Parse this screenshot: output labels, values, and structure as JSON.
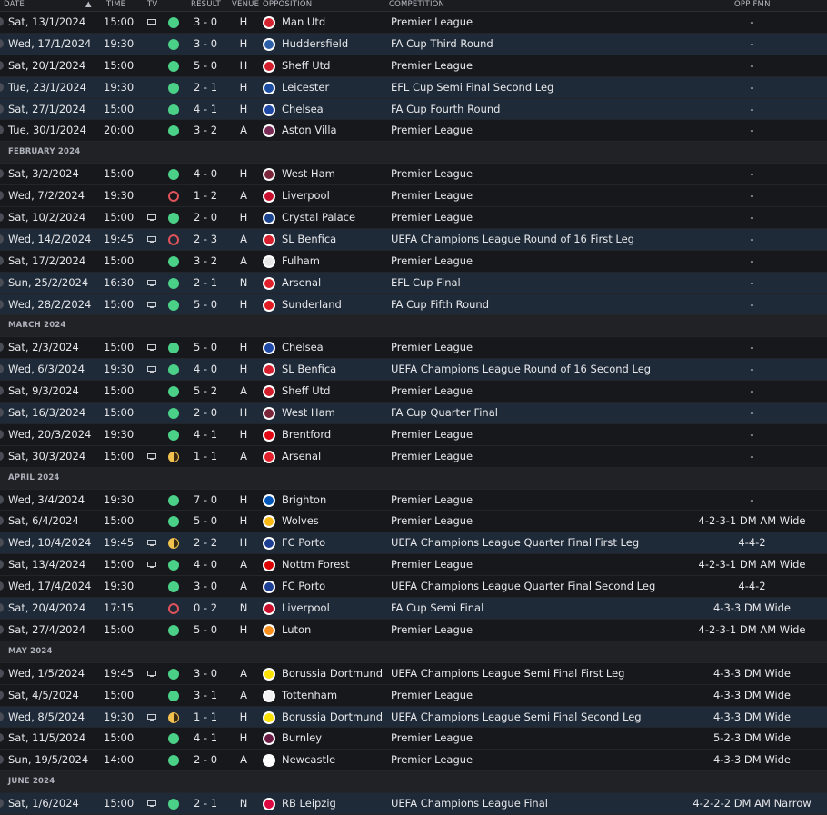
{
  "headers": {
    "date": "DATE",
    "time": "TIME",
    "tv": "TV",
    "result": "RESULT",
    "venue": "VENUE",
    "opposition": "OPPOSITION",
    "competition": "COMPETITION",
    "opp_fmn": "OPP FMN"
  },
  "colors": {
    "win": "#4bd187",
    "loss": "#e0535a",
    "draw": "#f2c14e",
    "row_highlight": "#1f2a38"
  },
  "rows": [
    {
      "type": "match",
      "date": "Sat, 13/1/2024",
      "time": "15:00",
      "tv": true,
      "result": "win",
      "score": "3 - 0",
      "venue": "H",
      "opp": "Man Utd",
      "badge": "#d5222f",
      "comp": "Premier League",
      "fmn": "-",
      "hl": false
    },
    {
      "type": "match",
      "date": "Wed, 17/1/2024",
      "time": "19:30",
      "tv": false,
      "result": "win",
      "score": "3 - 0",
      "venue": "H",
      "opp": "Huddersfield",
      "badge": "#2b5fa8",
      "comp": "FA Cup Third Round",
      "fmn": "-",
      "hl": true
    },
    {
      "type": "match",
      "date": "Sat, 20/1/2024",
      "time": "15:00",
      "tv": false,
      "result": "win",
      "score": "5 - 0",
      "venue": "H",
      "opp": "Sheff Utd",
      "badge": "#d21e2b",
      "comp": "Premier League",
      "fmn": "-",
      "hl": false
    },
    {
      "type": "match",
      "date": "Tue, 23/1/2024",
      "time": "19:30",
      "tv": false,
      "result": "win",
      "score": "2 - 1",
      "venue": "H",
      "opp": "Leicester",
      "badge": "#1c4ea3",
      "comp": "EFL Cup Semi Final Second Leg",
      "fmn": "-",
      "hl": true
    },
    {
      "type": "match",
      "date": "Sat, 27/1/2024",
      "time": "15:00",
      "tv": false,
      "result": "win",
      "score": "4 - 1",
      "venue": "H",
      "opp": "Chelsea",
      "badge": "#1e49a5",
      "comp": "FA Cup Fourth Round",
      "fmn": "-",
      "hl": true
    },
    {
      "type": "match",
      "date": "Tue, 30/1/2024",
      "time": "20:00",
      "tv": false,
      "result": "win",
      "score": "3 - 2",
      "venue": "A",
      "opp": "Aston Villa",
      "badge": "#7a2b55",
      "comp": "Premier League",
      "fmn": "-",
      "hl": false
    },
    {
      "type": "month",
      "label": "FEBRUARY 2024"
    },
    {
      "type": "match",
      "date": "Sat, 3/2/2024",
      "time": "15:00",
      "tv": false,
      "result": "win",
      "score": "4 - 0",
      "venue": "H",
      "opp": "West Ham",
      "badge": "#7a263a",
      "comp": "Premier League",
      "fmn": "-",
      "hl": false
    },
    {
      "type": "match",
      "date": "Wed, 7/2/2024",
      "time": "19:30",
      "tv": false,
      "result": "loss",
      "score": "1 - 2",
      "venue": "A",
      "opp": "Liverpool",
      "badge": "#c8102e",
      "comp": "Premier League",
      "fmn": "-",
      "hl": false
    },
    {
      "type": "match",
      "date": "Sat, 10/2/2024",
      "time": "15:00",
      "tv": true,
      "result": "win",
      "score": "2 - 0",
      "venue": "H",
      "opp": "Crystal Palace",
      "badge": "#1b458f",
      "comp": "Premier League",
      "fmn": "-",
      "hl": false
    },
    {
      "type": "match",
      "date": "Wed, 14/2/2024",
      "time": "19:45",
      "tv": true,
      "result": "loss",
      "score": "2 - 3",
      "venue": "A",
      "opp": "SL Benfica",
      "badge": "#d6202f",
      "comp": "UEFA Champions League Round of 16 First Leg",
      "fmn": "-",
      "hl": true
    },
    {
      "type": "match",
      "date": "Sat, 17/2/2024",
      "time": "15:00",
      "tv": false,
      "result": "win",
      "score": "3 - 2",
      "venue": "A",
      "opp": "Fulham",
      "badge": "#e8e8e8",
      "comp": "Premier League",
      "fmn": "-",
      "hl": false
    },
    {
      "type": "match",
      "date": "Sun, 25/2/2024",
      "time": "16:30",
      "tv": true,
      "result": "win",
      "score": "2 - 1",
      "venue": "N",
      "opp": "Arsenal",
      "badge": "#e2202b",
      "comp": "EFL Cup Final",
      "fmn": "-",
      "hl": true
    },
    {
      "type": "match",
      "date": "Wed, 28/2/2024",
      "time": "15:00",
      "tv": true,
      "result": "win",
      "score": "5 - 0",
      "venue": "H",
      "opp": "Sunderland",
      "badge": "#e11b22",
      "comp": "FA Cup Fifth Round",
      "fmn": "-",
      "hl": true
    },
    {
      "type": "month",
      "label": "MARCH 2024"
    },
    {
      "type": "match",
      "date": "Sat, 2/3/2024",
      "time": "15:00",
      "tv": true,
      "result": "win",
      "score": "5 - 0",
      "venue": "H",
      "opp": "Chelsea",
      "badge": "#1e49a5",
      "comp": "Premier League",
      "fmn": "-",
      "hl": false
    },
    {
      "type": "match",
      "date": "Wed, 6/3/2024",
      "time": "19:30",
      "tv": true,
      "result": "win",
      "score": "4 - 0",
      "venue": "H",
      "opp": "SL Benfica",
      "badge": "#d6202f",
      "comp": "UEFA Champions League Round of 16 Second Leg",
      "fmn": "-",
      "hl": true
    },
    {
      "type": "match",
      "date": "Sat, 9/3/2024",
      "time": "15:00",
      "tv": false,
      "result": "win",
      "score": "5 - 2",
      "venue": "A",
      "opp": "Sheff Utd",
      "badge": "#d21e2b",
      "comp": "Premier League",
      "fmn": "-",
      "hl": false
    },
    {
      "type": "match",
      "date": "Sat, 16/3/2024",
      "time": "15:00",
      "tv": false,
      "result": "win",
      "score": "2 - 0",
      "venue": "H",
      "opp": "West Ham",
      "badge": "#7a263a",
      "comp": "FA Cup Quarter Final",
      "fmn": "-",
      "hl": true
    },
    {
      "type": "match",
      "date": "Wed, 20/3/2024",
      "time": "19:30",
      "tv": false,
      "result": "win",
      "score": "4 - 1",
      "venue": "H",
      "opp": "Brentford",
      "badge": "#e30613",
      "comp": "Premier League",
      "fmn": "-",
      "hl": false
    },
    {
      "type": "match",
      "date": "Sat, 30/3/2024",
      "time": "15:00",
      "tv": true,
      "result": "draw",
      "score": "1 - 1",
      "venue": "A",
      "opp": "Arsenal",
      "badge": "#e2202b",
      "comp": "Premier League",
      "fmn": "-",
      "hl": false
    },
    {
      "type": "month",
      "label": "APRIL 2024"
    },
    {
      "type": "match",
      "date": "Wed, 3/4/2024",
      "time": "19:30",
      "tv": false,
      "result": "win",
      "score": "7 - 0",
      "venue": "H",
      "opp": "Brighton",
      "badge": "#0057b8",
      "comp": "Premier League",
      "fmn": "-",
      "hl": false
    },
    {
      "type": "match",
      "date": "Sat, 6/4/2024",
      "time": "15:00",
      "tv": false,
      "result": "win",
      "score": "5 - 0",
      "venue": "H",
      "opp": "Wolves",
      "badge": "#fdb913",
      "comp": "Premier League",
      "fmn": "4-2-3-1 DM AM Wide",
      "hl": false
    },
    {
      "type": "match",
      "date": "Wed, 10/4/2024",
      "time": "19:45",
      "tv": true,
      "result": "draw",
      "score": "2 - 2",
      "venue": "H",
      "opp": "FC Porto",
      "badge": "#1c3f94",
      "comp": "UEFA Champions League Quarter Final First Leg",
      "fmn": "4-4-2",
      "hl": true
    },
    {
      "type": "match",
      "date": "Sat, 13/4/2024",
      "time": "15:00",
      "tv": true,
      "result": "win",
      "score": "4 - 0",
      "venue": "A",
      "opp": "Nottm Forest",
      "badge": "#dd0000",
      "comp": "Premier League",
      "fmn": "4-2-3-1 DM AM Wide",
      "hl": false
    },
    {
      "type": "match",
      "date": "Wed, 17/4/2024",
      "time": "19:30",
      "tv": false,
      "result": "win",
      "score": "3 - 0",
      "venue": "A",
      "opp": "FC Porto",
      "badge": "#1c3f94",
      "comp": "UEFA Champions League Quarter Final Second Leg",
      "fmn": "4-4-2",
      "hl": false
    },
    {
      "type": "match",
      "date": "Sat, 20/4/2024",
      "time": "17:15",
      "tv": false,
      "result": "loss",
      "score": "0 - 2",
      "venue": "N",
      "opp": "Liverpool",
      "badge": "#c8102e",
      "comp": "FA Cup Semi Final",
      "fmn": "4-3-3 DM Wide",
      "hl": true
    },
    {
      "type": "match",
      "date": "Sat, 27/4/2024",
      "time": "15:00",
      "tv": false,
      "result": "win",
      "score": "5 - 0",
      "venue": "H",
      "opp": "Luton",
      "badge": "#f78f1e",
      "comp": "Premier League",
      "fmn": "4-2-3-1 DM AM Wide",
      "hl": false
    },
    {
      "type": "month",
      "label": "MAY 2024"
    },
    {
      "type": "match",
      "date": "Wed, 1/5/2024",
      "time": "19:45",
      "tv": true,
      "result": "win",
      "score": "3 - 0",
      "venue": "A",
      "opp": "Borussia Dortmund",
      "badge": "#fde100",
      "comp": "UEFA Champions League Semi Final First Leg",
      "fmn": "4-3-3 DM Wide",
      "hl": false
    },
    {
      "type": "match",
      "date": "Sat, 4/5/2024",
      "time": "15:00",
      "tv": false,
      "result": "win",
      "score": "3 - 1",
      "venue": "A",
      "opp": "Tottenham",
      "badge": "#f2f2f2",
      "comp": "Premier League",
      "fmn": "4-3-3 DM Wide",
      "hl": false
    },
    {
      "type": "match",
      "date": "Wed, 8/5/2024",
      "time": "19:30",
      "tv": true,
      "result": "draw",
      "score": "1 - 1",
      "venue": "H",
      "opp": "Borussia Dortmund",
      "badge": "#fde100",
      "comp": "UEFA Champions League Semi Final Second Leg",
      "fmn": "4-3-3 DM Wide",
      "hl": true
    },
    {
      "type": "match",
      "date": "Sat, 11/5/2024",
      "time": "15:00",
      "tv": false,
      "result": "win",
      "score": "4 - 1",
      "venue": "H",
      "opp": "Burnley",
      "badge": "#6c1d45",
      "comp": "Premier League",
      "fmn": "5-2-3 DM Wide",
      "hl": false
    },
    {
      "type": "match",
      "date": "Sun, 19/5/2024",
      "time": "14:00",
      "tv": false,
      "result": "win",
      "score": "2 - 0",
      "venue": "A",
      "opp": "Newcastle",
      "badge": "#ffffff",
      "comp": "Premier League",
      "fmn": "4-3-3 DM Wide",
      "hl": false
    },
    {
      "type": "month",
      "label": "JUNE 2024"
    },
    {
      "type": "match",
      "date": "Sat, 1/6/2024",
      "time": "15:00",
      "tv": true,
      "result": "win",
      "score": "2 - 1",
      "venue": "N",
      "opp": "RB Leipzig",
      "badge": "#dd0741",
      "comp": "UEFA Champions League Final",
      "fmn": "4-2-2-2 DM AM Narrow",
      "hl": true
    }
  ]
}
